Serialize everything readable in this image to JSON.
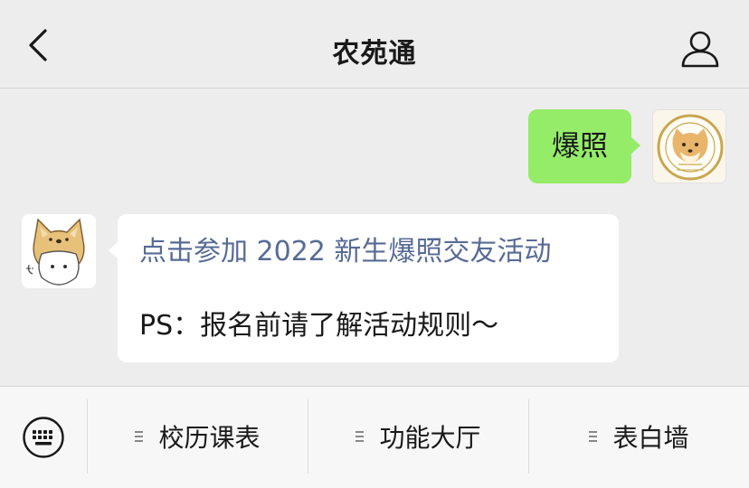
{
  "navbar": {
    "title": "农苑通",
    "back_icon": "chevron-left-icon",
    "profile_icon": "user-icon"
  },
  "messages": {
    "outgoing": {
      "text": "爆照",
      "bubble_color": "#95ec69"
    },
    "incoming": {
      "link_text": "点击参加 2022 新生爆照交友活动",
      "link_color": "#576b95",
      "body_text": "PS：报名前请了解活动规则～"
    }
  },
  "menu": {
    "keyboard_icon": "keyboard-icon",
    "items": [
      {
        "label": "校历课表"
      },
      {
        "label": "功能大厅"
      },
      {
        "label": "表白墙"
      }
    ]
  }
}
